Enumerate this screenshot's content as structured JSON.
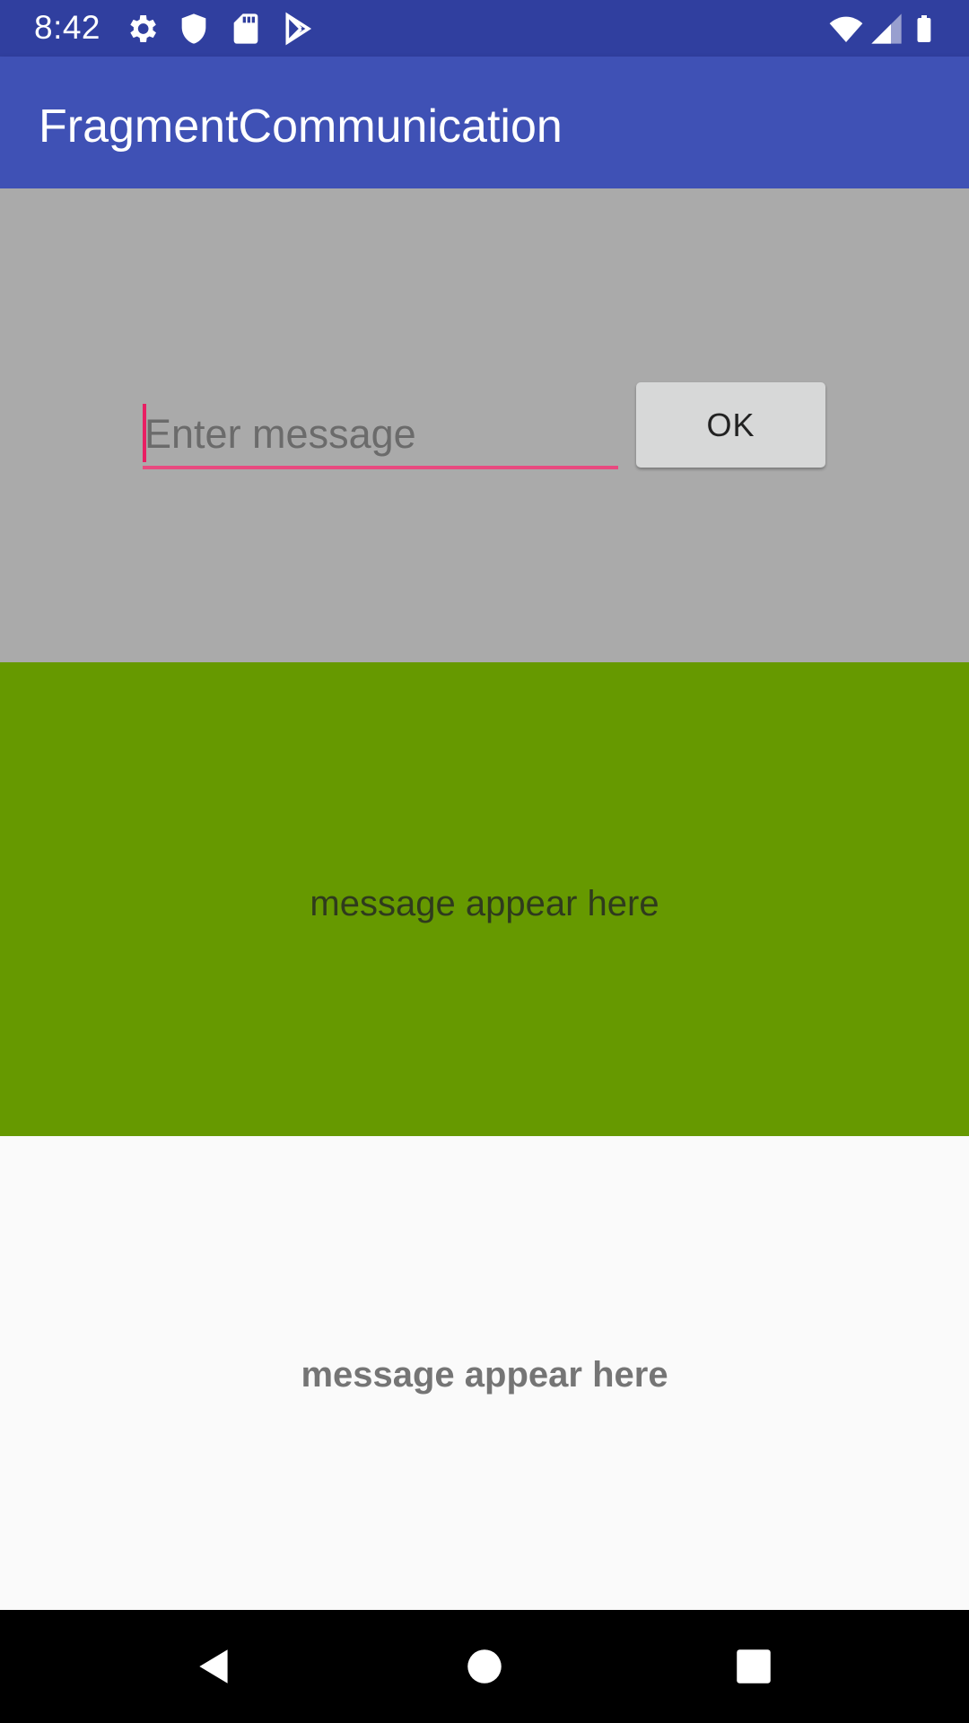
{
  "status_bar": {
    "time": "8:42",
    "left_icons": [
      "gear-icon",
      "shield-icon",
      "sd-card-icon",
      "play-store-icon"
    ],
    "right_icons": [
      "wifi-icon",
      "signal-icon",
      "battery-icon"
    ]
  },
  "app_bar": {
    "title": "FragmentCommunication",
    "color": "#3F51B5"
  },
  "fragment_input": {
    "background": "#AAAAAA",
    "message_field": {
      "value": "",
      "placeholder": "Enter message",
      "accent": "#E91E63"
    },
    "ok_button_label": "OK"
  },
  "fragment_green": {
    "background": "#669900",
    "message": "message appear here"
  },
  "fragment_white": {
    "background": "#FAFAFA",
    "message": "message appear here"
  },
  "nav_bar": {
    "icons": [
      "back-icon",
      "home-icon",
      "recents-icon"
    ]
  }
}
